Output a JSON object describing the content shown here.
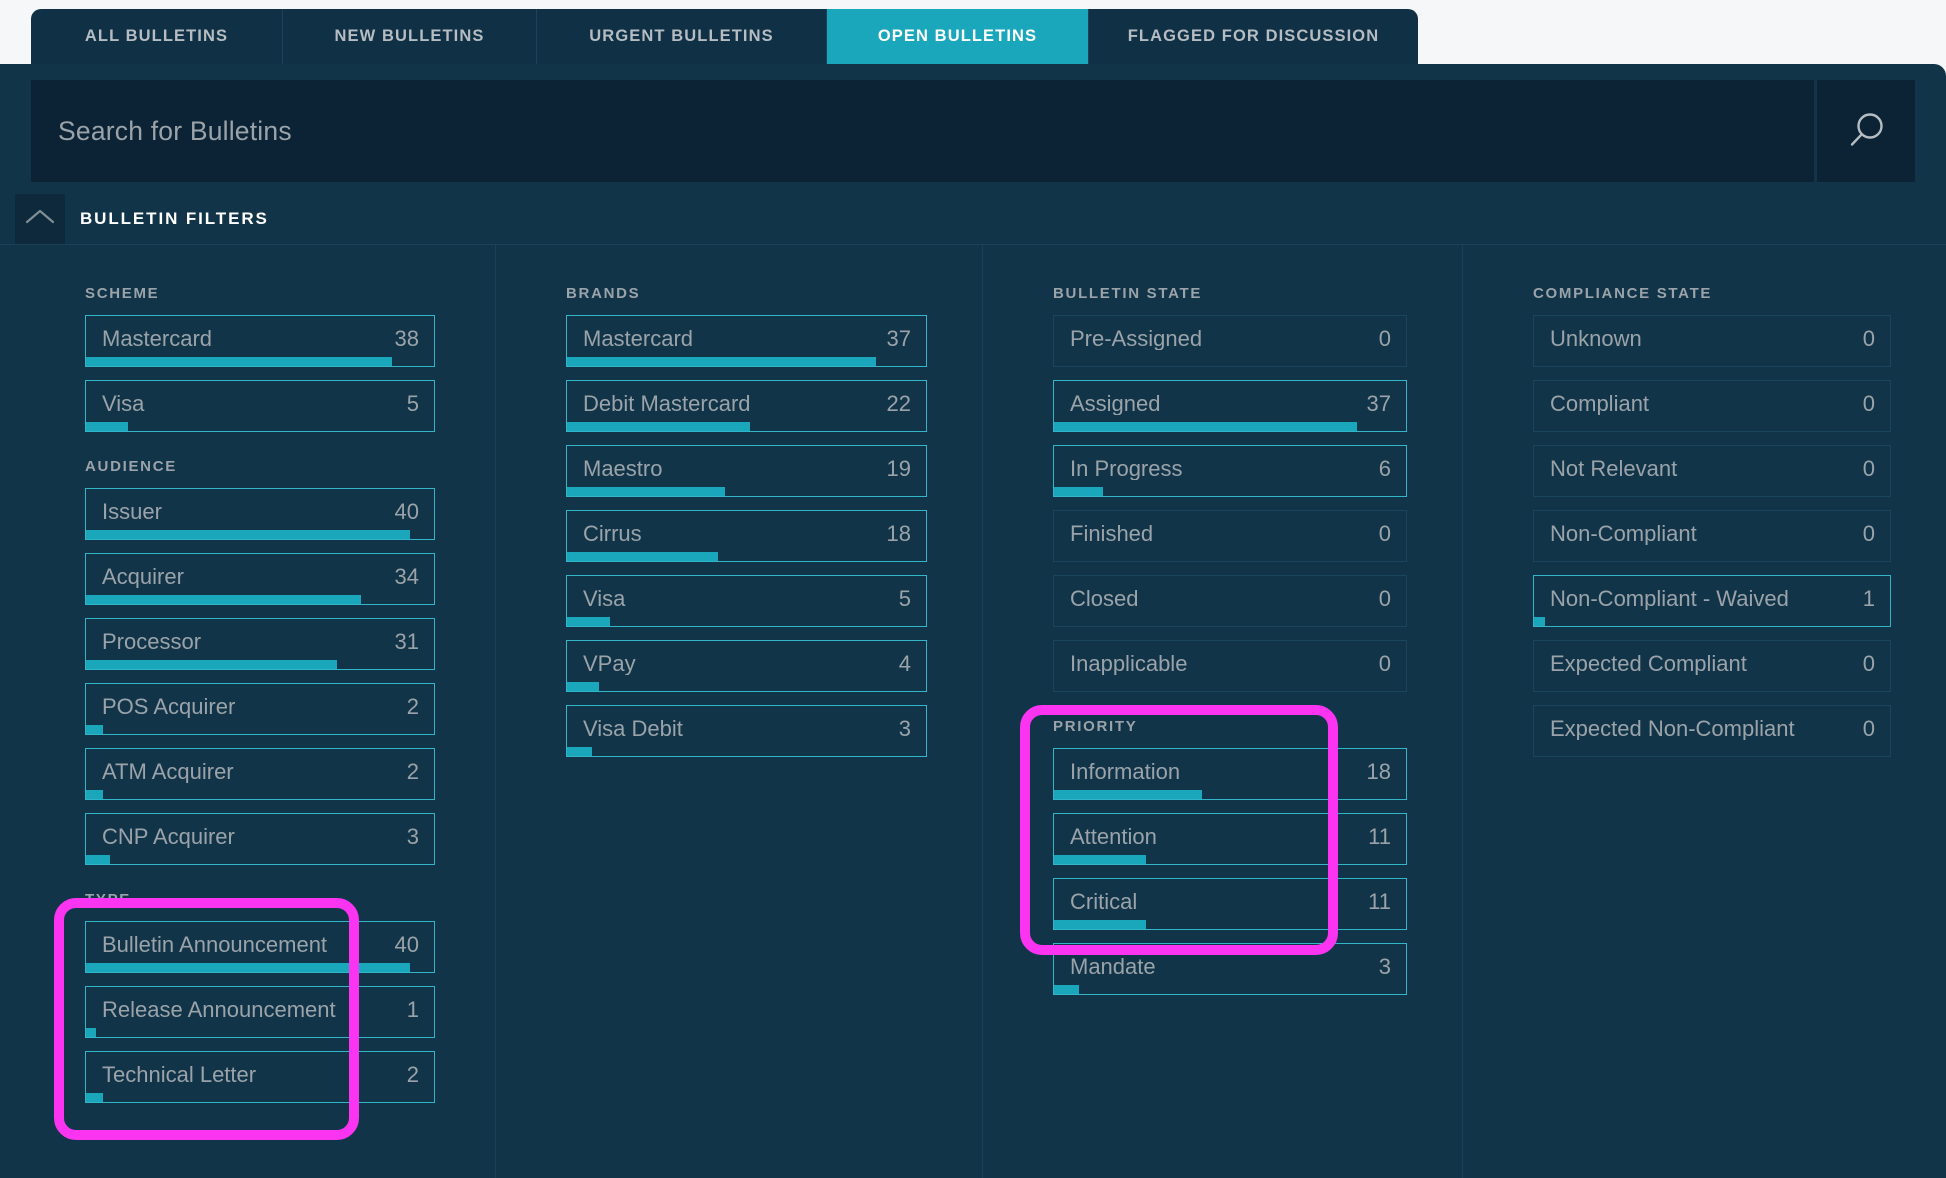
{
  "tabs": [
    {
      "label": "All Bulletins",
      "active": false
    },
    {
      "label": "New Bulletins",
      "active": false
    },
    {
      "label": "Urgent Bulletins",
      "active": false
    },
    {
      "label": "Open Bulletins",
      "active": true
    },
    {
      "label": "Flagged for Discussion",
      "active": false
    }
  ],
  "search": {
    "placeholder": "Search for Bulletins",
    "value": "",
    "icon": "search-icon"
  },
  "filters_header": {
    "title": "Bulletin Filters",
    "collapse_icon": "chevron-up-icon"
  },
  "columns": [
    {
      "name": "column-1",
      "groups": [
        {
          "title": "Scheme",
          "items": [
            {
              "label": "Mastercard",
              "count": "38",
              "bar_pct": 88,
              "active": true
            },
            {
              "label": "Visa",
              "count": "5",
              "bar_pct": 12,
              "active": true
            }
          ]
        },
        {
          "title": "Audience",
          "items": [
            {
              "label": "Issuer",
              "count": "40",
              "bar_pct": 93,
              "active": true
            },
            {
              "label": "Acquirer",
              "count": "34",
              "bar_pct": 79,
              "active": true
            },
            {
              "label": "Processor",
              "count": "31",
              "bar_pct": 72,
              "active": true
            },
            {
              "label": "POS Acquirer",
              "count": "2",
              "bar_pct": 5,
              "active": true
            },
            {
              "label": "ATM Acquirer",
              "count": "2",
              "bar_pct": 5,
              "active": true
            },
            {
              "label": "CNP Acquirer",
              "count": "3",
              "bar_pct": 7,
              "active": true
            }
          ]
        },
        {
          "title": "Type",
          "highlighted": true,
          "items": [
            {
              "label": "Bulletin Announcement",
              "count": "40",
              "bar_pct": 93,
              "active": true
            },
            {
              "label": "Release Announcement",
              "count": "1",
              "bar_pct": 3,
              "active": true
            },
            {
              "label": "Technical Letter",
              "count": "2",
              "bar_pct": 5,
              "active": true
            }
          ]
        }
      ]
    },
    {
      "name": "column-2",
      "groups": [
        {
          "title": "Brands",
          "items": [
            {
              "label": "Mastercard",
              "count": "37",
              "bar_pct": 86,
              "active": true
            },
            {
              "label": "Debit Mastercard",
              "count": "22",
              "bar_pct": 51,
              "active": true
            },
            {
              "label": "Maestro",
              "count": "19",
              "bar_pct": 44,
              "active": true
            },
            {
              "label": "Cirrus",
              "count": "18",
              "bar_pct": 42,
              "active": true
            },
            {
              "label": "Visa",
              "count": "5",
              "bar_pct": 12,
              "active": true
            },
            {
              "label": "VPay",
              "count": "4",
              "bar_pct": 9,
              "active": true
            },
            {
              "label": "Visa Debit",
              "count": "3",
              "bar_pct": 7,
              "active": true
            }
          ]
        }
      ]
    },
    {
      "name": "column-3",
      "groups": [
        {
          "title": "Bulletin State",
          "items": [
            {
              "label": "Pre-Assigned",
              "count": "0",
              "bar_pct": 0,
              "active": false
            },
            {
              "label": "Assigned",
              "count": "37",
              "bar_pct": 86,
              "active": true
            },
            {
              "label": "In Progress",
              "count": "6",
              "bar_pct": 14,
              "active": true
            },
            {
              "label": "Finished",
              "count": "0",
              "bar_pct": 0,
              "active": false
            },
            {
              "label": "Closed",
              "count": "0",
              "bar_pct": 0,
              "active": false
            },
            {
              "label": "Inapplicable",
              "count": "0",
              "bar_pct": 0,
              "active": false
            }
          ]
        },
        {
          "title": "Priority",
          "highlighted": true,
          "items": [
            {
              "label": "Information",
              "count": "18",
              "bar_pct": 42,
              "active": true
            },
            {
              "label": "Attention",
              "count": "11",
              "bar_pct": 26,
              "active": true
            },
            {
              "label": "Critical",
              "count": "11",
              "bar_pct": 26,
              "active": true
            },
            {
              "label": "Mandate",
              "count": "3",
              "bar_pct": 7,
              "active": true
            }
          ]
        }
      ]
    },
    {
      "name": "column-4",
      "groups": [
        {
          "title": "Compliance State",
          "items": [
            {
              "label": "Unknown",
              "count": "0",
              "bar_pct": 0,
              "active": false
            },
            {
              "label": "Compliant",
              "count": "0",
              "bar_pct": 0,
              "active": false
            },
            {
              "label": "Not Relevant",
              "count": "0",
              "bar_pct": 0,
              "active": false
            },
            {
              "label": "Non-Compliant",
              "count": "0",
              "bar_pct": 0,
              "active": false
            },
            {
              "label": "Non-Compliant - Waived",
              "count": "1",
              "bar_pct": 3,
              "active": true
            },
            {
              "label": "Expected Compliant",
              "count": "0",
              "bar_pct": 0,
              "active": false
            },
            {
              "label": "Expected Non-Compliant",
              "count": "0",
              "bar_pct": 0,
              "active": false
            }
          ]
        }
      ]
    }
  ],
  "annotations": [
    {
      "name": "highlight-type-group",
      "color": "#fa34f0"
    },
    {
      "name": "highlight-priority-group",
      "color": "#fa34f0"
    }
  ],
  "colors": {
    "page_background": "#f6f7f8",
    "panel_background": "#123449",
    "tabbar_background": "#103046",
    "tab_active": "#1aa7bc",
    "search_background": "#0b2334",
    "accent_teal": "#1aa7bc",
    "border_teal": "#31b6c9",
    "border_muted": "#1a455d",
    "text_muted": "#9aa3a9",
    "annotation_magenta": "#fa34f0"
  }
}
